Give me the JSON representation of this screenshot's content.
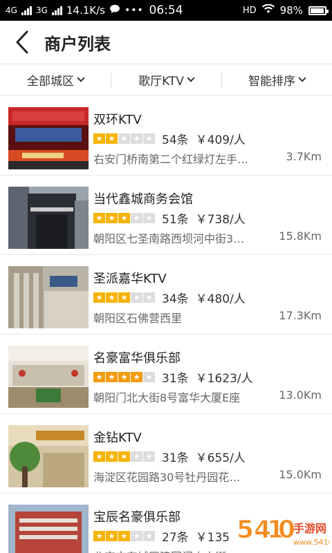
{
  "status_bar": {
    "net_left": "4G",
    "net_mid": "3G",
    "speed": "14.1K/s",
    "dots": "•••",
    "time": "06:54",
    "hd": "HD",
    "battery": "98%"
  },
  "header": {
    "title": "商户列表"
  },
  "filters": [
    {
      "label": "全部城区"
    },
    {
      "label": "歌厅KTV"
    },
    {
      "label": "智能排序"
    }
  ],
  "listings": [
    {
      "name": "双环KTV",
      "rating": 2,
      "reviews": "54条",
      "price": "￥409/人",
      "address": "右安门桥南第二个红绿灯左手…",
      "distance": "3.7Km"
    },
    {
      "name": "当代鑫城商务会馆",
      "rating": 3,
      "reviews": "51条",
      "price": "￥738/人",
      "address": "朝阳区七圣南路西坝河中街3…",
      "distance": "15.8Km"
    },
    {
      "name": "圣派嘉华KTV",
      "rating": 3,
      "reviews": "34条",
      "price": "￥480/人",
      "address": "朝阳区石佛营西里",
      "distance": "17.3Km"
    },
    {
      "name": "名豪富华俱乐部",
      "rating": 4,
      "reviews": "31条",
      "price": "￥1623/人",
      "address": "朝阳门北大街8号富华大厦E座",
      "distance": "13.0Km"
    },
    {
      "name": "金钻KTV",
      "rating": 3,
      "reviews": "31条",
      "price": "￥655/人",
      "address": "海淀区花园路30号牡丹园花…",
      "distance": "15.0Km"
    },
    {
      "name": "宝辰名豪俱乐部",
      "rating": 3,
      "reviews": "27条",
      "price": "￥135",
      "address": "北京市东城区建国门内大街",
      "distance": ""
    }
  ],
  "watermark": {
    "text": "5410手游网",
    "sub": "www.5410.cn"
  },
  "colors": {
    "star_yellow": "#f6b300",
    "star_orange": "#f39c12",
    "star_off": "#dddddd"
  }
}
